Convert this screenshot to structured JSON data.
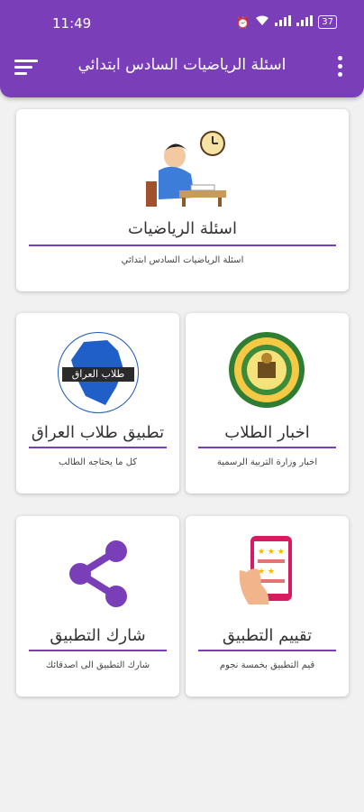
{
  "status_bar": {
    "time": "11:49",
    "battery": "37"
  },
  "app_bar": {
    "title": "اسئلة الرياضيات السادس ابتدائي"
  },
  "cards": {
    "math": {
      "title": "اسئلة الرياضيات",
      "subtitle": "اسئلة الرياضيات السادس ابتدائي"
    },
    "news": {
      "title": "اخبار الطلاب",
      "subtitle": "اخبار وزارة التربية الرسمية"
    },
    "iraq": {
      "title": "تطبيق طلاب العراق",
      "subtitle": "كل ما يحتاجه الطالب",
      "logo_text": "طلاب العراق"
    },
    "rate": {
      "title": "تقييم التطبيق",
      "subtitle": "قيم التطبيق بخمسة نجوم"
    },
    "share": {
      "title": "شارك التطبيق",
      "subtitle": "شارك التطبيق الى اصدقائك"
    }
  },
  "colors": {
    "primary": "#7a3fb8",
    "share_icon": "#7a3fb8"
  }
}
